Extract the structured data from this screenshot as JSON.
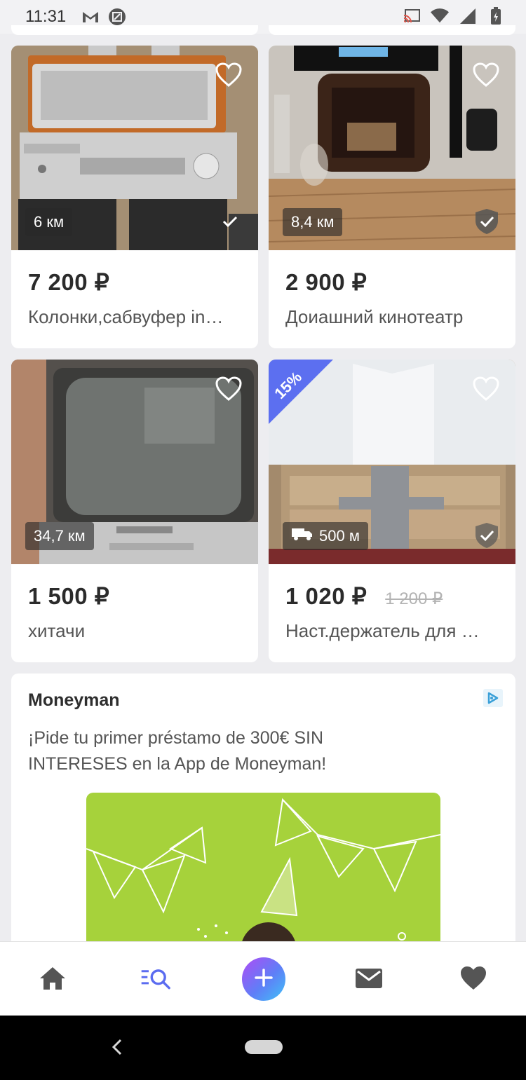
{
  "status_bar": {
    "time": "11:31",
    "icons": [
      "gmail-icon",
      "screenshot-icon",
      "cast-icon",
      "wifi-icon",
      "signal-icon",
      "battery-charging-icon"
    ]
  },
  "listings": [
    {
      "price": "7 200 ₽",
      "old_price": "",
      "title": "Колонки,сабвуфер in…",
      "distance": "6 км",
      "favorite": false,
      "verified": true,
      "discount": "",
      "delivery": false,
      "photo": "stereo-amplifier"
    },
    {
      "price": "2 900 ₽",
      "old_price": "",
      "title": "Доиашний кинотеатр",
      "distance": "8,4 км",
      "favorite": false,
      "verified": true,
      "discount": "",
      "delivery": false,
      "photo": "tv-stand-room"
    },
    {
      "price": "1 500 ₽",
      "old_price": "",
      "title": "хитачи",
      "distance": "34,7 км",
      "favorite": false,
      "verified": false,
      "discount": "",
      "delivery": false,
      "photo": "crt-tv"
    },
    {
      "price": "1 020 ₽",
      "old_price": "1 200 ₽",
      "title": "Наст.держатель для …",
      "distance": "500 м",
      "favorite": false,
      "verified": true,
      "discount": "15%",
      "delivery": true,
      "photo": "wall-mount-bracket"
    }
  ],
  "ad": {
    "advertiser": "Moneyman",
    "text": "¡Pide tu primer préstamo de 300€ SIN INTERESES en la App de Moneyman!",
    "adchoices_icon": "adchoices-icon",
    "banner_color": "#a6d23b"
  },
  "bottom_nav": {
    "items": [
      "home-icon",
      "search-list-icon",
      "add-icon",
      "messages-icon",
      "favorites-icon"
    ],
    "active": "search-list-icon",
    "accent": "#5b6cf0"
  }
}
